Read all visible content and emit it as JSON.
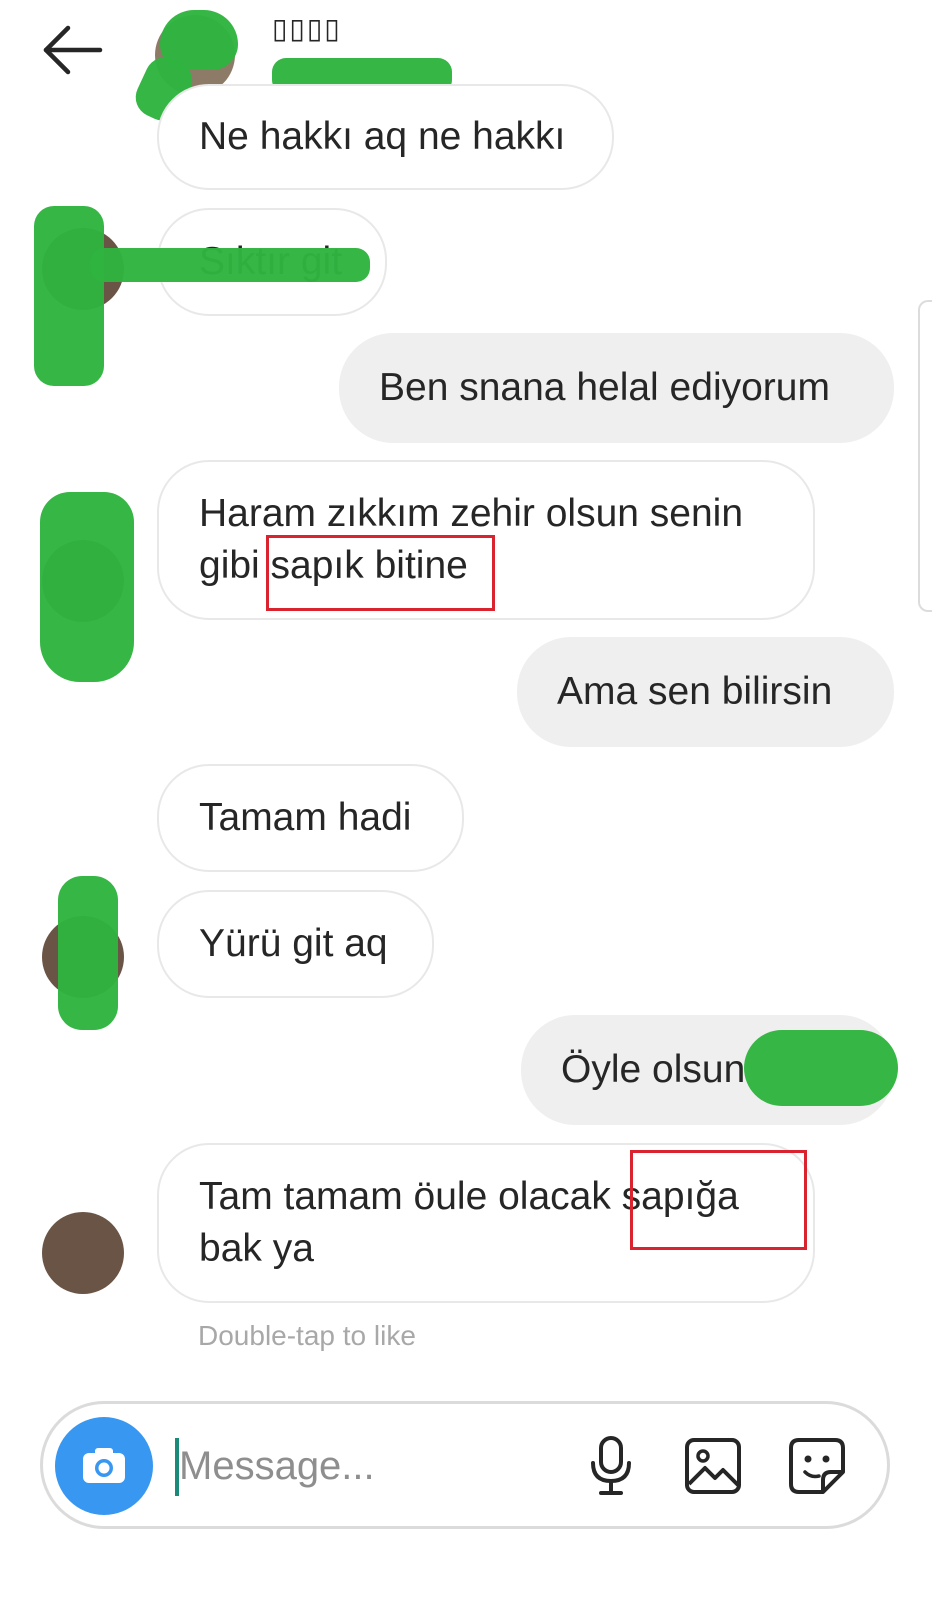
{
  "header": {
    "username": "▯▯▯▯"
  },
  "messages": [
    {
      "id": "m1",
      "direction": "incoming",
      "text": "Ne hakkı aq ne hakkı"
    },
    {
      "id": "m2",
      "direction": "incoming",
      "text": "Sıktır git"
    },
    {
      "id": "m3",
      "direction": "outgoing",
      "text": "Ben snana helal ediyorum"
    },
    {
      "id": "m4",
      "direction": "incoming",
      "text": "Haram zıkkım zehir olsun senin\ngibi sapık bitine"
    },
    {
      "id": "m5",
      "direction": "outgoing",
      "text": "Ama sen bilirsin"
    },
    {
      "id": "m6",
      "direction": "incoming",
      "text": "Tamam hadi"
    },
    {
      "id": "m7",
      "direction": "incoming",
      "text": "Yürü git aq"
    },
    {
      "id": "m8",
      "direction": "outgoing",
      "text": "Öyle olsun"
    },
    {
      "id": "m9",
      "direction": "incoming",
      "text": "Tam tamam öule olacak sapığa\nbak ya"
    }
  ],
  "hint": "Double-tap to like",
  "composer": {
    "placeholder": "Message...",
    "icons": [
      "camera-icon",
      "microphone-icon",
      "gallery-icon",
      "sticker-icon"
    ]
  },
  "colors": {
    "accent": "#3897f0",
    "outgoing_bubble": "#efefef",
    "incoming_border": "#e8e8e8",
    "redaction": "#2fb43f",
    "annotation_box": "#d9232e"
  }
}
